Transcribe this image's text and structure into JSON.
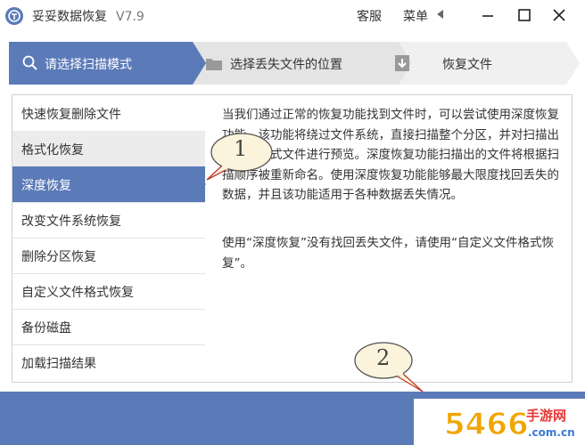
{
  "titlebar": {
    "app_name": "妥妥数据恢复",
    "version": "V7.9",
    "service": "客服",
    "menu": "菜单"
  },
  "steps": [
    {
      "label": "请选择扫描模式",
      "icon": "search-icon",
      "active": true
    },
    {
      "label": "选择丢失文件的位置",
      "icon": "folder-icon",
      "active": false
    },
    {
      "label": "恢复文件",
      "icon": "restore-icon",
      "active": false
    }
  ],
  "modes": [
    {
      "label": "快速恢复删除文件"
    },
    {
      "label": "格式化恢复"
    },
    {
      "label": "深度恢复"
    },
    {
      "label": "改变文件系统恢复"
    },
    {
      "label": "删除分区恢复"
    },
    {
      "label": "自定义文件格式恢复"
    },
    {
      "label": "备份磁盘"
    },
    {
      "label": "加载扫描结果"
    }
  ],
  "description": {
    "p1": "当我们通过正常的恢复功能找到文件时，可以尝试使用深度恢复功能。该功能将绕过文件系统，直接扫描整个分区，并对扫描出的常用格式文件进行预览。深度恢复功能扫描出的文件将根据扫描顺序被重新命名。使用深度恢复功能能够最大限度找回丢失的数据，并且该功能适用于各种数据丢失情况。",
    "p2": "使用“深度恢复”没有找回丢失文件，请使用“自定义文件格式恢复”。"
  },
  "callouts": {
    "one": "1",
    "two": "2"
  },
  "colors": {
    "accent": "#5b7ab8",
    "active_text": "#ffffff",
    "hover_row": "#ececec",
    "callout_fill": "#fbf3dc"
  },
  "watermark": {
    "brand": "5466",
    "brand_cn": "手游网",
    "domain": ".com.cn"
  }
}
